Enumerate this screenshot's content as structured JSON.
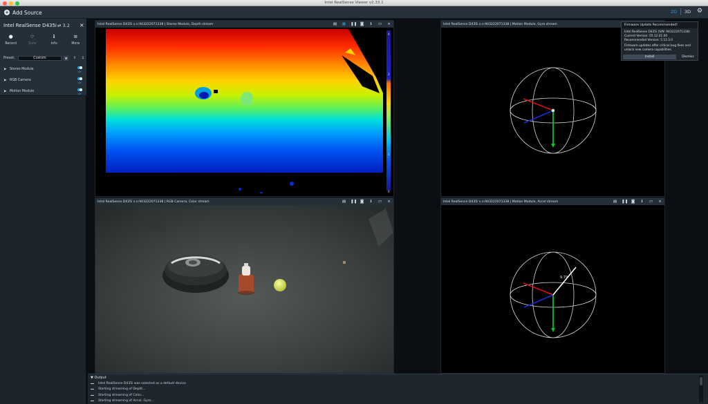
{
  "window": {
    "title": "Intel RealSense Viewer v2.33.1"
  },
  "toolbar": {
    "add_source": "Add Source",
    "view_2d": "2D",
    "view_3d": "3D",
    "settings_icon": "gear-icon"
  },
  "device": {
    "name": "Intel RealSense D435i",
    "usb": "3.2",
    "actions": [
      {
        "label": "Record",
        "icon": "record-icon",
        "enabled": true
      },
      {
        "label": "Sync",
        "icon": "sync-icon",
        "enabled": false
      },
      {
        "label": "Info",
        "icon": "info-icon",
        "enabled": true
      },
      {
        "label": "More",
        "icon": "menu-icon",
        "enabled": true
      }
    ],
    "preset_label": "Preset:",
    "preset_value": "Custom",
    "modules": [
      {
        "name": "Stereo Module",
        "state": "off"
      },
      {
        "name": "RGB Camera",
        "state": "off"
      },
      {
        "name": "Motion Module",
        "state": "off"
      }
    ]
  },
  "streams": {
    "depth": {
      "title": "Intel RealSense D435i s.n:943222071338 | Stereo Module, Depth stream"
    },
    "gyro": {
      "title": "Intel RealSense D435i s.n:943222071338 | Motion Module, Gyro stream"
    },
    "color": {
      "title": "Intel RealSense D435i s.n:943222071338 | RGB Camera, Color stream"
    },
    "accel": {
      "title": "Intel RealSense D435i s.n:943222071338 | Motion Module, Accel stream"
    }
  },
  "depth_colorbar": {
    "ticks": [
      "4",
      "3",
      "2",
      "1",
      "0"
    ]
  },
  "accel_readout": "9.79",
  "firmware": {
    "title": "Firmware Update Recommended!",
    "device_line": "Intel RealSense D435i       (S/N: 943222071338)",
    "current": "Current Version: 05.12.01.00",
    "recommended": "Recommended Version: 5.12.3.0",
    "desc1": "Firmware updates offer critical bug fixes and",
    "desc2": "unlock new camera capabilities.",
    "install": "Install",
    "dismiss": "Dismiss"
  },
  "output": {
    "title": "Output",
    "lines": [
      "Intel RealSense D435i was selected as a default device",
      "Starting streaming of Depth...",
      "Starting streaming of Color...",
      "Starting streaming of Accel, Gyro..."
    ]
  }
}
